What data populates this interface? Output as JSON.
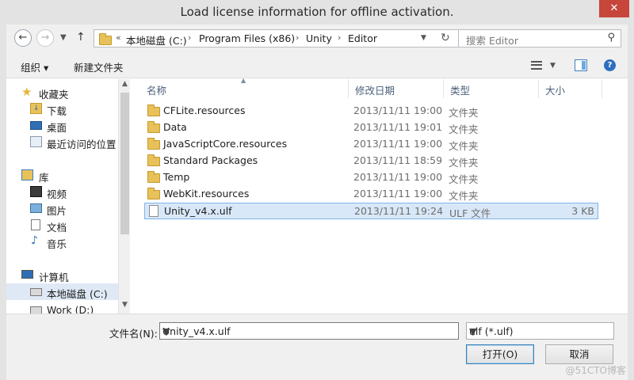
{
  "window": {
    "title": "Load license information for offline activation.",
    "close_glyph": "✕"
  },
  "address": {
    "back_glyph": "←",
    "forward_glyph": "→",
    "up_glyph": "↑",
    "overflow": "«",
    "crumbs": [
      "本地磁盘 (C:)",
      "Program Files (x86)",
      "Unity",
      "Editor"
    ],
    "sep": "›",
    "refresh_glyph": "↻"
  },
  "search": {
    "placeholder": "搜索 Editor",
    "icon_glyph": "⚲"
  },
  "toolbar": {
    "organize": "组织 ▾",
    "new_folder": "新建文件夹"
  },
  "nav": {
    "items": [
      {
        "label": "收藏夹",
        "icon": "star-icon"
      },
      {
        "label": "下载",
        "icon": "download-icon"
      },
      {
        "label": "桌面",
        "icon": "desktop-icon"
      },
      {
        "label": "最近访问的位置",
        "icon": "recent-places-icon"
      },
      {
        "label": "库",
        "icon": "library-icon"
      },
      {
        "label": "视频",
        "icon": "video-icon"
      },
      {
        "label": "图片",
        "icon": "pictures-icon"
      },
      {
        "label": "文档",
        "icon": "documents-icon"
      },
      {
        "label": "音乐",
        "icon": "music-icon"
      },
      {
        "label": "计算机",
        "icon": "computer-icon"
      },
      {
        "label": "本地磁盘 (C:)",
        "icon": "drive-icon"
      },
      {
        "label": "Work (D:)",
        "icon": "drive-icon"
      }
    ]
  },
  "columns": {
    "name": "名称",
    "date": "修改日期",
    "type": "类型",
    "size": "大小"
  },
  "files": [
    {
      "name": "CFLite.resources",
      "date": "2013/11/11 19:00",
      "type": "文件夹",
      "size": ""
    },
    {
      "name": "Data",
      "date": "2013/11/11 19:01",
      "type": "文件夹",
      "size": ""
    },
    {
      "name": "JavaScriptCore.resources",
      "date": "2013/11/11 19:00",
      "type": "文件夹",
      "size": ""
    },
    {
      "name": "Standard Packages",
      "date": "2013/11/11 18:59",
      "type": "文件夹",
      "size": ""
    },
    {
      "name": "Temp",
      "date": "2013/11/11 19:00",
      "type": "文件夹",
      "size": ""
    },
    {
      "name": "WebKit.resources",
      "date": "2013/11/11 19:00",
      "type": "文件夹",
      "size": ""
    },
    {
      "name": "Unity_v4.x.ulf",
      "date": "2013/11/11 19:24",
      "type": "ULF 文件",
      "size": "3 KB"
    }
  ],
  "bottom": {
    "filename_label": "文件名(N):",
    "filename_value": "Unity_v4.x.ulf",
    "filetype_value": "ulf (*.ulf)",
    "open_label": "打开(O)",
    "cancel_label": "取消"
  },
  "watermark": "@51CTO博客"
}
